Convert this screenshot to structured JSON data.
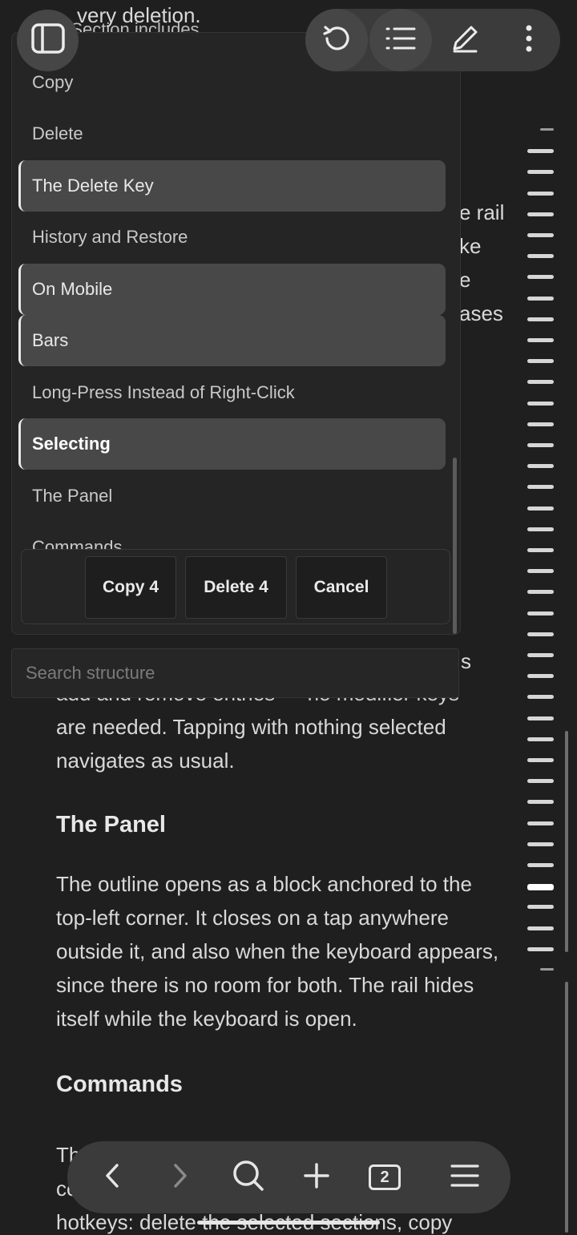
{
  "toolbar": {
    "sidebar_icon": "sidebar-toggle-icon",
    "history_icon": "history-icon",
    "outline_icon": "list-icon",
    "edit_icon": "pencil-icon",
    "more_icon": "more-vertical-icon"
  },
  "document": {
    "top_fragment_1": "very deletion.",
    "top_fragment_2": "a Section includes",
    "right_fragments": [
      "e rail",
      "ke",
      "e",
      "ases"
    ],
    "bottom_fragment_s": "s",
    "partial_line": "add and remove entries — no modifier keys",
    "partial_line_end": "eys",
    "para1_end": "are needed. Tapping with nothing selected navigates as usual.",
    "heading_panel": "The Panel",
    "para2": "The outline opens as a block anchored to the top-left corner. It closes on a tap anywhere outside it, and also when the keyboard appears, since there is no room for both. The rail hides itself while the keyboard is open.",
    "heading_commands": "Commands",
    "para3_start": "Th",
    "para3_line2": "cc",
    "para3_line3": "hotkeys: delete the selected sections, copy"
  },
  "outline": {
    "items": [
      {
        "label": "Copy",
        "selected": false
      },
      {
        "label": "Delete",
        "selected": false
      },
      {
        "label": "The Delete Key",
        "selected": true
      },
      {
        "label": "History and Restore",
        "selected": false
      },
      {
        "label": "On Mobile",
        "selected": true
      },
      {
        "label": "Bars",
        "selected": true
      },
      {
        "label": "Long-Press Instead of Right-Click",
        "selected": false
      },
      {
        "label": "Selecting",
        "selected": true,
        "current": true
      },
      {
        "label": "The Panel",
        "selected": false
      },
      {
        "label": "Commands",
        "selected": false
      }
    ],
    "actions": {
      "copy_label": "Copy 4",
      "delete_label": "Delete 4",
      "cancel_label": "Cancel"
    }
  },
  "search": {
    "placeholder": "Search structure",
    "value": ""
  },
  "bottom_nav": {
    "back_icon": "chevron-left-icon",
    "forward_icon": "chevron-right-icon",
    "search_icon": "search-icon",
    "add_icon": "plus-icon",
    "tabs_count": "2",
    "menu_icon": "hamburger-menu-icon"
  },
  "colors": {
    "background": "#1f1f1f",
    "panel": "#252525",
    "selected_row": "#484848",
    "toolbar_button": "#464646"
  }
}
